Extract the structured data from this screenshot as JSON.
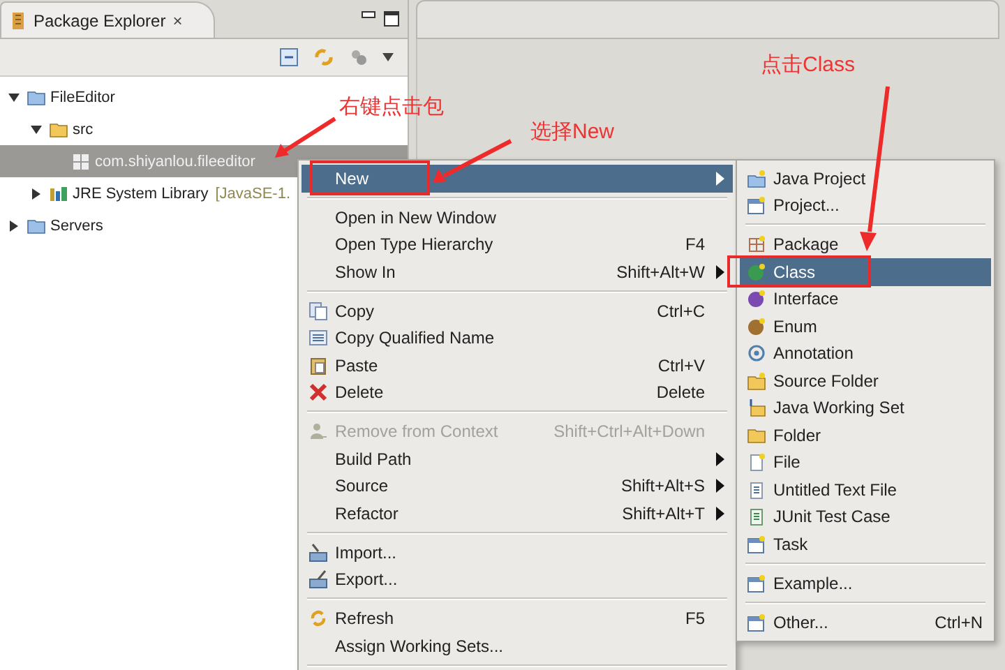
{
  "package_explorer": {
    "title": "Package Explorer",
    "close": "×",
    "tree": [
      {
        "label": "FileEditor",
        "expanded": true,
        "selected": false,
        "children": [
          {
            "label": "src",
            "expanded": true,
            "selected": false,
            "children": [
              {
                "label": "com.shiyanlou.fileeditor",
                "selected": true
              }
            ]
          },
          {
            "label": "JRE System Library",
            "suffix": "[JavaSE-1.",
            "expanded": false,
            "selected": false
          }
        ]
      },
      {
        "label": "Servers",
        "expanded": false,
        "selected": false
      }
    ]
  },
  "context_menu": {
    "items": [
      {
        "kind": "item",
        "label": "New",
        "submenu": true,
        "selected": true,
        "disabled": false
      },
      {
        "kind": "separator"
      },
      {
        "kind": "item",
        "label": "Open in New Window",
        "submenu": false,
        "selected": false,
        "disabled": false
      },
      {
        "kind": "item",
        "label": "Open Type Hierarchy",
        "shortcut": "F4",
        "submenu": false,
        "selected": false,
        "disabled": false
      },
      {
        "kind": "item",
        "label": "Show In",
        "shortcut": "Shift+Alt+W",
        "submenu": true,
        "selected": false,
        "disabled": false
      },
      {
        "kind": "separator"
      },
      {
        "kind": "item",
        "label": "Copy",
        "shortcut": "Ctrl+C",
        "submenu": false,
        "selected": false,
        "disabled": false
      },
      {
        "kind": "item",
        "label": "Copy Qualified Name",
        "submenu": false,
        "selected": false,
        "disabled": false
      },
      {
        "kind": "item",
        "label": "Paste",
        "shortcut": "Ctrl+V",
        "submenu": false,
        "selected": false,
        "disabled": false
      },
      {
        "kind": "item",
        "label": "Delete",
        "shortcut": "Delete",
        "submenu": false,
        "selected": false,
        "disabled": false
      },
      {
        "kind": "separator"
      },
      {
        "kind": "item",
        "label": "Remove from Context",
        "shortcut": "Shift+Ctrl+Alt+Down",
        "submenu": false,
        "selected": false,
        "disabled": true
      },
      {
        "kind": "item",
        "label": "Build Path",
        "submenu": true,
        "selected": false,
        "disabled": false
      },
      {
        "kind": "item",
        "label": "Source",
        "shortcut": "Shift+Alt+S",
        "submenu": true,
        "selected": false,
        "disabled": false
      },
      {
        "kind": "item",
        "label": "Refactor",
        "shortcut": "Shift+Alt+T",
        "submenu": true,
        "selected": false,
        "disabled": false
      },
      {
        "kind": "separator"
      },
      {
        "kind": "item",
        "label": "Import...",
        "submenu": false,
        "selected": false,
        "disabled": false
      },
      {
        "kind": "item",
        "label": "Export...",
        "submenu": false,
        "selected": false,
        "disabled": false
      },
      {
        "kind": "separator"
      },
      {
        "kind": "item",
        "label": "Refresh",
        "shortcut": "F5",
        "submenu": false,
        "selected": false,
        "disabled": false
      },
      {
        "kind": "item",
        "label": "Assign Working Sets...",
        "submenu": false,
        "selected": false,
        "disabled": false
      },
      {
        "kind": "separator"
      }
    ]
  },
  "new_submenu": {
    "items": [
      {
        "kind": "item",
        "label": "Java Project",
        "selected": false
      },
      {
        "kind": "item",
        "label": "Project...",
        "selected": false
      },
      {
        "kind": "separator"
      },
      {
        "kind": "item",
        "label": "Package",
        "selected": false
      },
      {
        "kind": "item",
        "label": "Class",
        "selected": true
      },
      {
        "kind": "item",
        "label": "Interface",
        "selected": false
      },
      {
        "kind": "item",
        "label": "Enum",
        "selected": false
      },
      {
        "kind": "item",
        "label": "Annotation",
        "selected": false
      },
      {
        "kind": "item",
        "label": "Source Folder",
        "selected": false
      },
      {
        "kind": "item",
        "label": "Java Working Set",
        "selected": false
      },
      {
        "kind": "item",
        "label": "Folder",
        "selected": false
      },
      {
        "kind": "item",
        "label": "File",
        "selected": false
      },
      {
        "kind": "item",
        "label": "Untitled Text File",
        "selected": false
      },
      {
        "kind": "item",
        "label": "JUnit Test Case",
        "selected": false
      },
      {
        "kind": "item",
        "label": "Task",
        "selected": false
      },
      {
        "kind": "separator"
      },
      {
        "kind": "item",
        "label": "Example...",
        "selected": false
      },
      {
        "kind": "separator"
      },
      {
        "kind": "item",
        "label": "Other...",
        "shortcut": "Ctrl+N",
        "selected": false
      }
    ]
  },
  "annotations": [
    {
      "text": "右键点击包"
    },
    {
      "text": "选择New"
    },
    {
      "text": "点击Class"
    }
  ]
}
